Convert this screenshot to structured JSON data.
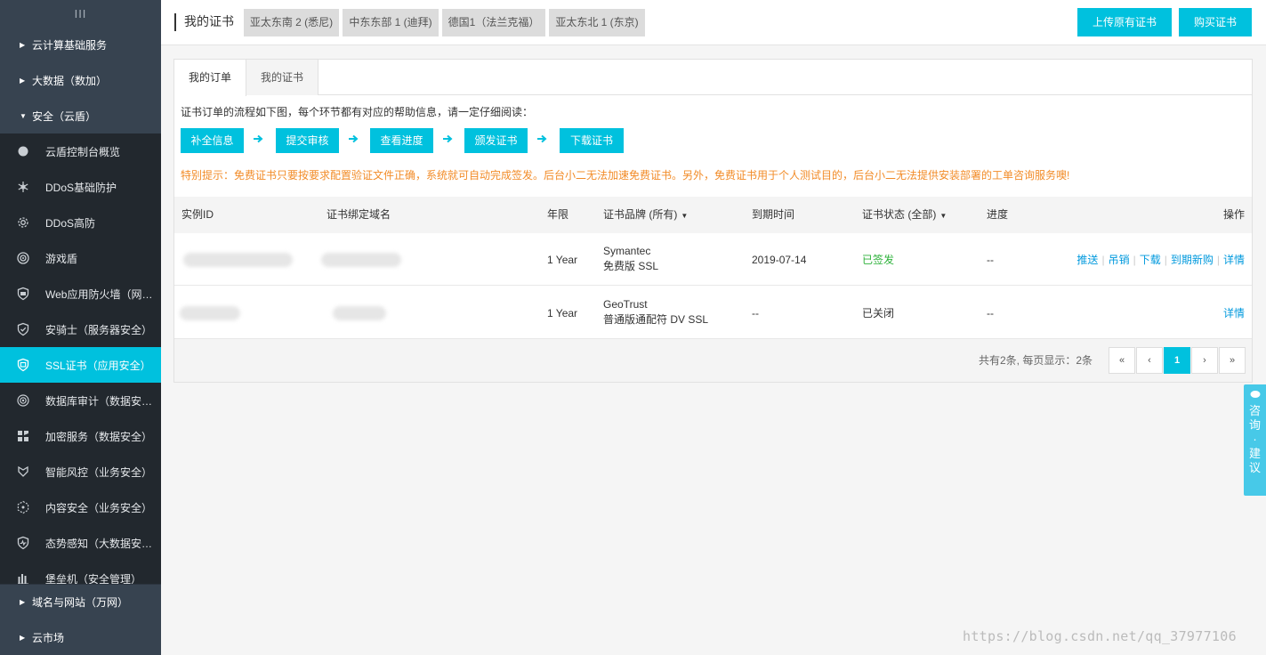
{
  "sidebar": {
    "grip": "III",
    "top_items": [
      {
        "label": "云计算基础服务",
        "expanded": false
      },
      {
        "label": "大数据（数加）",
        "expanded": false
      },
      {
        "label": "安全（云盾）",
        "expanded": true
      }
    ],
    "sub_items": [
      {
        "label": "云盾控制台概览",
        "icon": "circle-icon"
      },
      {
        "label": "DDoS基础防护",
        "icon": "network-icon"
      },
      {
        "label": "DDoS高防",
        "icon": "gear-icon"
      },
      {
        "label": "游戏盾",
        "icon": "target-icon"
      },
      {
        "label": "Web应用防火墙（网…",
        "icon": "firewall-shield-icon"
      },
      {
        "label": "安骑士（服务器安全）",
        "icon": "shield-icon"
      },
      {
        "label": "SSL证书（应用安全）",
        "icon": "certificate-icon",
        "active": true
      },
      {
        "label": "数据库审计（数据安…",
        "icon": "radar-icon"
      },
      {
        "label": "加密服务（数据安全）",
        "icon": "puzzle-icon"
      },
      {
        "label": "智能风控（业务安全）",
        "icon": "risk-icon"
      },
      {
        "label": "内容安全（业务安全）",
        "icon": "hexagon-icon"
      },
      {
        "label": "态势感知（大数据安…",
        "icon": "heartbeat-shield-icon"
      },
      {
        "label": "堡垒机（安全管理）",
        "icon": "bars-icon"
      }
    ],
    "bottom_items": [
      {
        "label": "域名与网站（万网）"
      },
      {
        "label": "云市场"
      }
    ]
  },
  "topbar": {
    "title": "我的证书",
    "regions": [
      "亚太东南 2 (悉尼)",
      "中东东部 1 (迪拜)",
      "德国1（法兰克福）",
      "亚太东北 1 (东京)"
    ],
    "upload_button": "上传原有证书",
    "buy_button": "购买证书"
  },
  "tabs": [
    "我的订单",
    "我的证书"
  ],
  "intro": "证书订单的流程如下图，每个环节都有对应的帮助信息，请一定仔细阅读：",
  "steps": [
    "补全信息",
    "提交审核",
    "查看进度",
    "颁发证书",
    "下载证书"
  ],
  "notice": "特别提示：免费证书只要按要求配置验证文件正确，系统就可自动完成签发。后台小二无法加速免费证书。另外，免费证书用于个人测试目的，后台小二无法提供安装部署的工单咨询服务噢!",
  "table": {
    "headers": {
      "instance_id": "实例ID",
      "domain": "证书绑定域名",
      "term": "年限",
      "brand": "证书品牌 (所有)",
      "expiry": "到期时间",
      "status": "证书状态 (全部)",
      "progress": "进度",
      "ops": "操作"
    },
    "rows": [
      {
        "term": "1 Year",
        "brand_line1": "Symantec",
        "brand_line2": "免费版 SSL",
        "expiry": "2019-07-14",
        "status": "已签发",
        "progress": "--",
        "actions": [
          "推送",
          "吊销",
          "下载",
          "到期新购",
          "详情"
        ]
      },
      {
        "term": "1 Year",
        "brand_line1": "GeoTrust",
        "brand_line2": "普通版通配符 DV SSL",
        "expiry": "--",
        "status": "已关闭",
        "progress": "--",
        "actions": [
          "详情"
        ]
      }
    ]
  },
  "pagination": {
    "info": "共有2条, 每页显示：2条",
    "first": "«",
    "prev": "‹",
    "current": "1",
    "next": "›",
    "last": "»"
  },
  "feedback": {
    "text": "咨询·建议"
  },
  "watermark": "https://blog.csdn.net/qq_37977106",
  "colors": {
    "accent": "#00c1de",
    "sidebar_bg": "#374350",
    "sidebar_sub_bg": "#22282e",
    "notice": "#f28c28",
    "signed": "#2eb23b",
    "link": "#0099dd"
  }
}
